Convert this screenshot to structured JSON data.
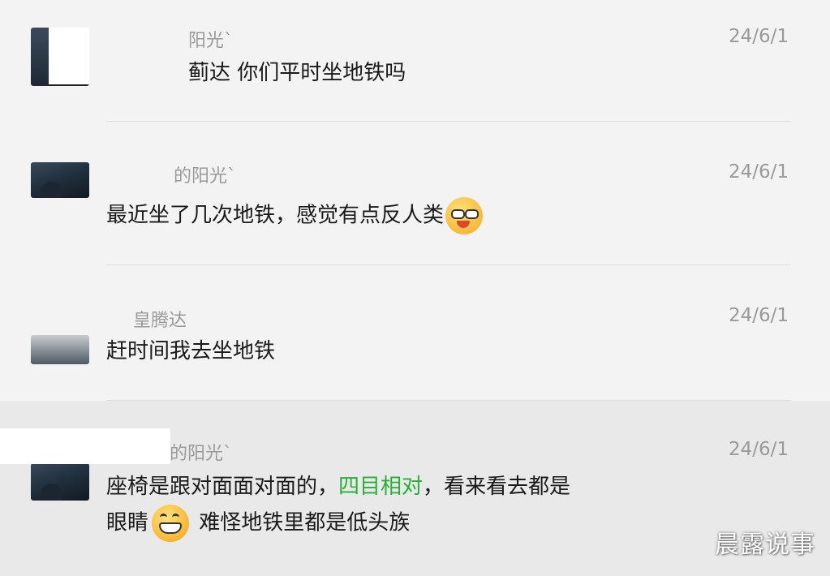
{
  "comments": [
    {
      "name": "阳光`",
      "time": "24/6/1",
      "text": "蓟达 你们平时坐地铁吗"
    },
    {
      "name": "的阳光`",
      "time": "24/6/1",
      "text": "最近坐了几次地铁，感觉有点反人类",
      "emoji": "smug-face-icon"
    },
    {
      "name": "皇腾达",
      "time": "24/6/1",
      "text": "赶时间我去坐地铁"
    },
    {
      "name": "的阳光`",
      "time": "24/6/1",
      "line1_before": "座椅是跟对面面对面的，",
      "line1_highlight": "四目相对",
      "line1_after": "，看来看去都是",
      "line2_before": "眼睛",
      "line2_after": " 难怪地铁里都是低头族",
      "emoji": "grinning-face-icon",
      "highlight_color": "#2aae3a"
    }
  ],
  "watermark": "晨露说事"
}
